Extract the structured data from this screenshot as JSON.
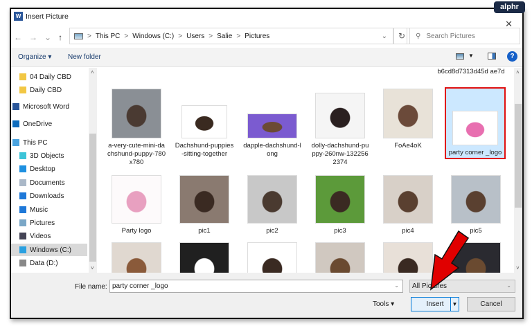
{
  "window": {
    "title": "Insert Picture",
    "close": "✕"
  },
  "nav": {
    "back": "←",
    "forward": "→",
    "recent": "⌄",
    "up": "↑"
  },
  "address": {
    "crumbs": [
      "This PC",
      "Windows (C:)",
      "Users",
      "Salie",
      "Pictures"
    ],
    "separator": ">",
    "dropdown": "⌄",
    "refresh": "↻"
  },
  "search": {
    "placeholder": "Search Pictures",
    "icon": "⚲"
  },
  "toolbar": {
    "organize": "Organize ▾",
    "new_folder": "New folder",
    "view_dd": "▼",
    "help": "?"
  },
  "sidebar": {
    "items": [
      {
        "label": "04 Daily CBD",
        "icon": "folder-icon",
        "color": "#f2c744"
      },
      {
        "label": "Daily CBD",
        "icon": "folder-icon",
        "color": "#f2c744"
      },
      {
        "label": "Microsoft Word",
        "icon": "word-icon",
        "color": "#2b579a"
      },
      {
        "label": "OneDrive",
        "icon": "cloud-icon",
        "color": "#0f6cbd"
      },
      {
        "label": "This PC",
        "icon": "computer-icon",
        "color": "#4aa3df"
      },
      {
        "label": "3D Objects",
        "icon": "cube-icon",
        "color": "#3cc4d8"
      },
      {
        "label": "Desktop",
        "icon": "desktop-icon",
        "color": "#1e90e0"
      },
      {
        "label": "Documents",
        "icon": "document-icon",
        "color": "#aab8c8"
      },
      {
        "label": "Downloads",
        "icon": "download-icon",
        "color": "#1e78d8"
      },
      {
        "label": "Music",
        "icon": "music-icon",
        "color": "#1e78d8"
      },
      {
        "label": "Pictures",
        "icon": "pictures-icon",
        "color": "#7aa7c7"
      },
      {
        "label": "Videos",
        "icon": "videos-icon",
        "color": "#445"
      },
      {
        "label": "Windows (C:)",
        "icon": "drive-icon",
        "color": "#2aa0e0",
        "selected": true
      },
      {
        "label": "Data (D:)",
        "icon": "drive-icon",
        "color": "#888"
      }
    ]
  },
  "files": {
    "partial_top_label": "b6cd8d7313d45d ae7d",
    "row1": [
      {
        "label": "a-very-cute-mini-dachshund-puppy-780x780",
        "colors": [
          "#8a8f95",
          "#4a3a32"
        ]
      },
      {
        "label": "Dachshund-puppies-sitting-together",
        "colors": [
          "#ffffff",
          "#3a2a20"
        ]
      },
      {
        "label": "dapple-dachshund-long",
        "colors": [
          "#7b5bd0",
          "#6b4a35"
        ]
      },
      {
        "label": "dolly-dachshund-puppy-260nw-1322562374",
        "colors": [
          "#f5f5f5",
          "#2a2020"
        ]
      },
      {
        "label": "FoAe4oK",
        "colors": [
          "#e8e2d8",
          "#6b4a3a"
        ]
      },
      {
        "label": "party corner _logo",
        "colors": [
          "#ffffff",
          "#e86fb0"
        ],
        "selected": true
      }
    ],
    "row2": [
      {
        "label": "Party logo",
        "colors": [
          "#fdfafb",
          "#e8a0c0"
        ]
      },
      {
        "label": "pic1",
        "colors": [
          "#8a7a70",
          "#3a2a22"
        ]
      },
      {
        "label": "pic2",
        "colors": [
          "#c8c8c8",
          "#4a3a30"
        ]
      },
      {
        "label": "pic3",
        "colors": [
          "#5c9a3a",
          "#3a2a22"
        ]
      },
      {
        "label": "pic4",
        "colors": [
          "#d8d0c8",
          "#5a4030"
        ]
      },
      {
        "label": "pic5",
        "colors": [
          "#b8c0c8",
          "#5a4030"
        ]
      }
    ],
    "row3": [
      {
        "colors": [
          "#e0d8d0",
          "#8a5a3a"
        ]
      },
      {
        "colors": [
          "#202020",
          "#ffffff"
        ]
      },
      {
        "colors": [
          "#ffffff",
          "#3a2a22"
        ]
      },
      {
        "colors": [
          "#d0c8c0",
          "#6a4a30"
        ]
      },
      {
        "colors": [
          "#e8e0d8",
          "#3a2a22"
        ]
      },
      {
        "colors": [
          "#2a2a30",
          "#6a4a30"
        ]
      }
    ]
  },
  "bottom": {
    "file_name_label": "File name:",
    "file_name_value": "party corner _logo",
    "file_type": "All Pictures",
    "dropdown": "⌄",
    "tools": "Tools  ▾",
    "insert": "Insert",
    "insert_split": "▼",
    "cancel": "Cancel"
  },
  "watermark": "alphr",
  "annotation": {
    "arrow_color": "#e00000"
  },
  "colors": {
    "accent": "#0078d7",
    "selection": "#cce8ff",
    "highlight_border": "#e01010"
  }
}
